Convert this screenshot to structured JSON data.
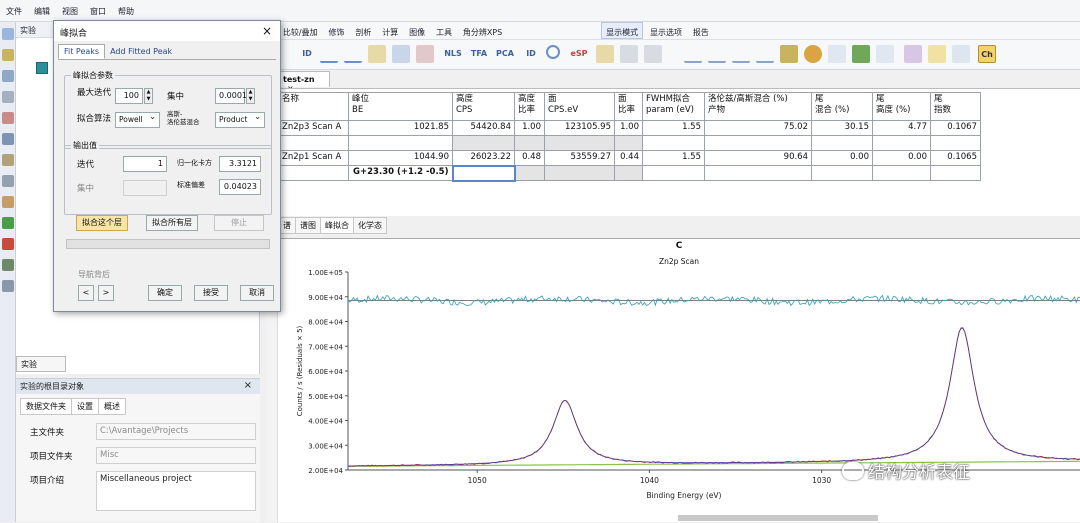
{
  "menu": [
    "文件",
    "编辑",
    "视图",
    "窗口",
    "帮助"
  ],
  "left_panel": {
    "title": "实验",
    "tab": "实验"
  },
  "object_panel": {
    "title": "实验的根目录对象",
    "tabs": [
      "数据文件夹",
      "设置",
      "概述"
    ],
    "rows": [
      {
        "label": "主文件夹",
        "value": "C:\\Avantage\\Projects"
      },
      {
        "label": "项目文件夹",
        "value": "Misc"
      },
      {
        "label": "项目介绍",
        "value": "Miscellaneous project"
      }
    ]
  },
  "toolbar": {
    "items": [
      "析",
      "比较/叠加",
      "修饰",
      "剖析",
      "计算",
      "图像",
      "工具",
      "角分辨XPS",
      "显示模式",
      "显示选项",
      "报告"
    ],
    "icons": [
      "ID",
      "NLS",
      "TFA",
      "PCA",
      "ID",
      "eSP",
      "Ch"
    ]
  },
  "document_tab": {
    "label": "test-zn",
    "close": "×"
  },
  "table": {
    "headers": [
      "名称",
      "峰位\nBE",
      "高度\nCPS",
      "高度\n比率",
      "面\nCPS.eV",
      "面\n比率",
      "FWHM拟合\nparam (eV)",
      "洛伦兹/高斯混合 (%)\n产物",
      "尾\n混合 (%)",
      "尾\n高度 (%)",
      "尾\n指数"
    ],
    "rows": [
      [
        "Zn2p3 Scan A",
        "1021.85",
        "54420.84",
        "1.00",
        "123105.95",
        "1.00",
        "1.55",
        "75.02",
        "30.15",
        "4.77",
        "0.1067"
      ],
      [
        "",
        "",
        "",
        "",
        "",
        "",
        "",
        "",
        "",
        "",
        ""
      ],
      [
        "Zn2p1 Scan A",
        "1044.90",
        "26023.22",
        "0.48",
        "53559.27",
        "0.44",
        "1.55",
        "90.64",
        "0.00",
        "0.00",
        "0.1065"
      ],
      [
        "",
        "G+23.30 (+1.2 -0.5)",
        "",
        "",
        "",
        "",
        "",
        "",
        "",
        "",
        ""
      ]
    ]
  },
  "subtabs": [
    "谱",
    "谱图",
    "峰拟合",
    "化学态"
  ],
  "dialog": {
    "title": "峰拟合",
    "close": "×",
    "tabs": [
      "Fit Peaks",
      "Add Fitted Peak"
    ],
    "params_group": "峰拟合参数",
    "max_iter_label": "最大迭代",
    "max_iter_value": "100",
    "convergence_label": "集中",
    "convergence_value": "0.0001",
    "algorithm_label": "拟合算法",
    "algorithm_value": "Powell",
    "mix_label": "高斯-\n洛伦兹混合",
    "mix_value": "Product",
    "output_group": "输出值",
    "iterations_label": "迭代",
    "iterations_value": "1",
    "chisq_label": "归一化卡方",
    "chisq_value": "3.3121",
    "conv_out_label": "集中",
    "stddev_label": "标准偏差",
    "stddev_value": "0.04023",
    "fit_this_button": "拟合这个层",
    "fit_all_button": "拟合所有层",
    "stop_button": "停止",
    "nav_label": "导航背后",
    "ok_button": "确定",
    "accept_button": "接受",
    "cancel_button": "取消"
  },
  "watermark": "结构分析表征",
  "chart_data": {
    "type": "line",
    "title": "C",
    "subtitle": "Zn2p Scan",
    "xlabel": "Binding Energy (eV)",
    "ylabel": "Counts / s  (Residuals × 5)",
    "x_reversed": true,
    "xlim": [
      1057.5,
      1015.0
    ],
    "ylim": [
      20000,
      100000
    ],
    "x_ticks": [
      1050,
      1040,
      1030
    ],
    "y_ticks": [
      "1.00E+05",
      "9.00E+04",
      "8.00E+04",
      "7.00E+04",
      "6.00E+04",
      "5.00E+04",
      "4.00E+04",
      "3.00E+04",
      "2.00E+04"
    ],
    "residual_level": 88500,
    "peaks": [
      {
        "center": 1044.9,
        "height": 26023.22,
        "fwhm": 1.55
      },
      {
        "center": 1021.85,
        "height": 54420.84,
        "fwhm": 1.55
      }
    ],
    "background_start": 21500,
    "background_end": 23500
  }
}
